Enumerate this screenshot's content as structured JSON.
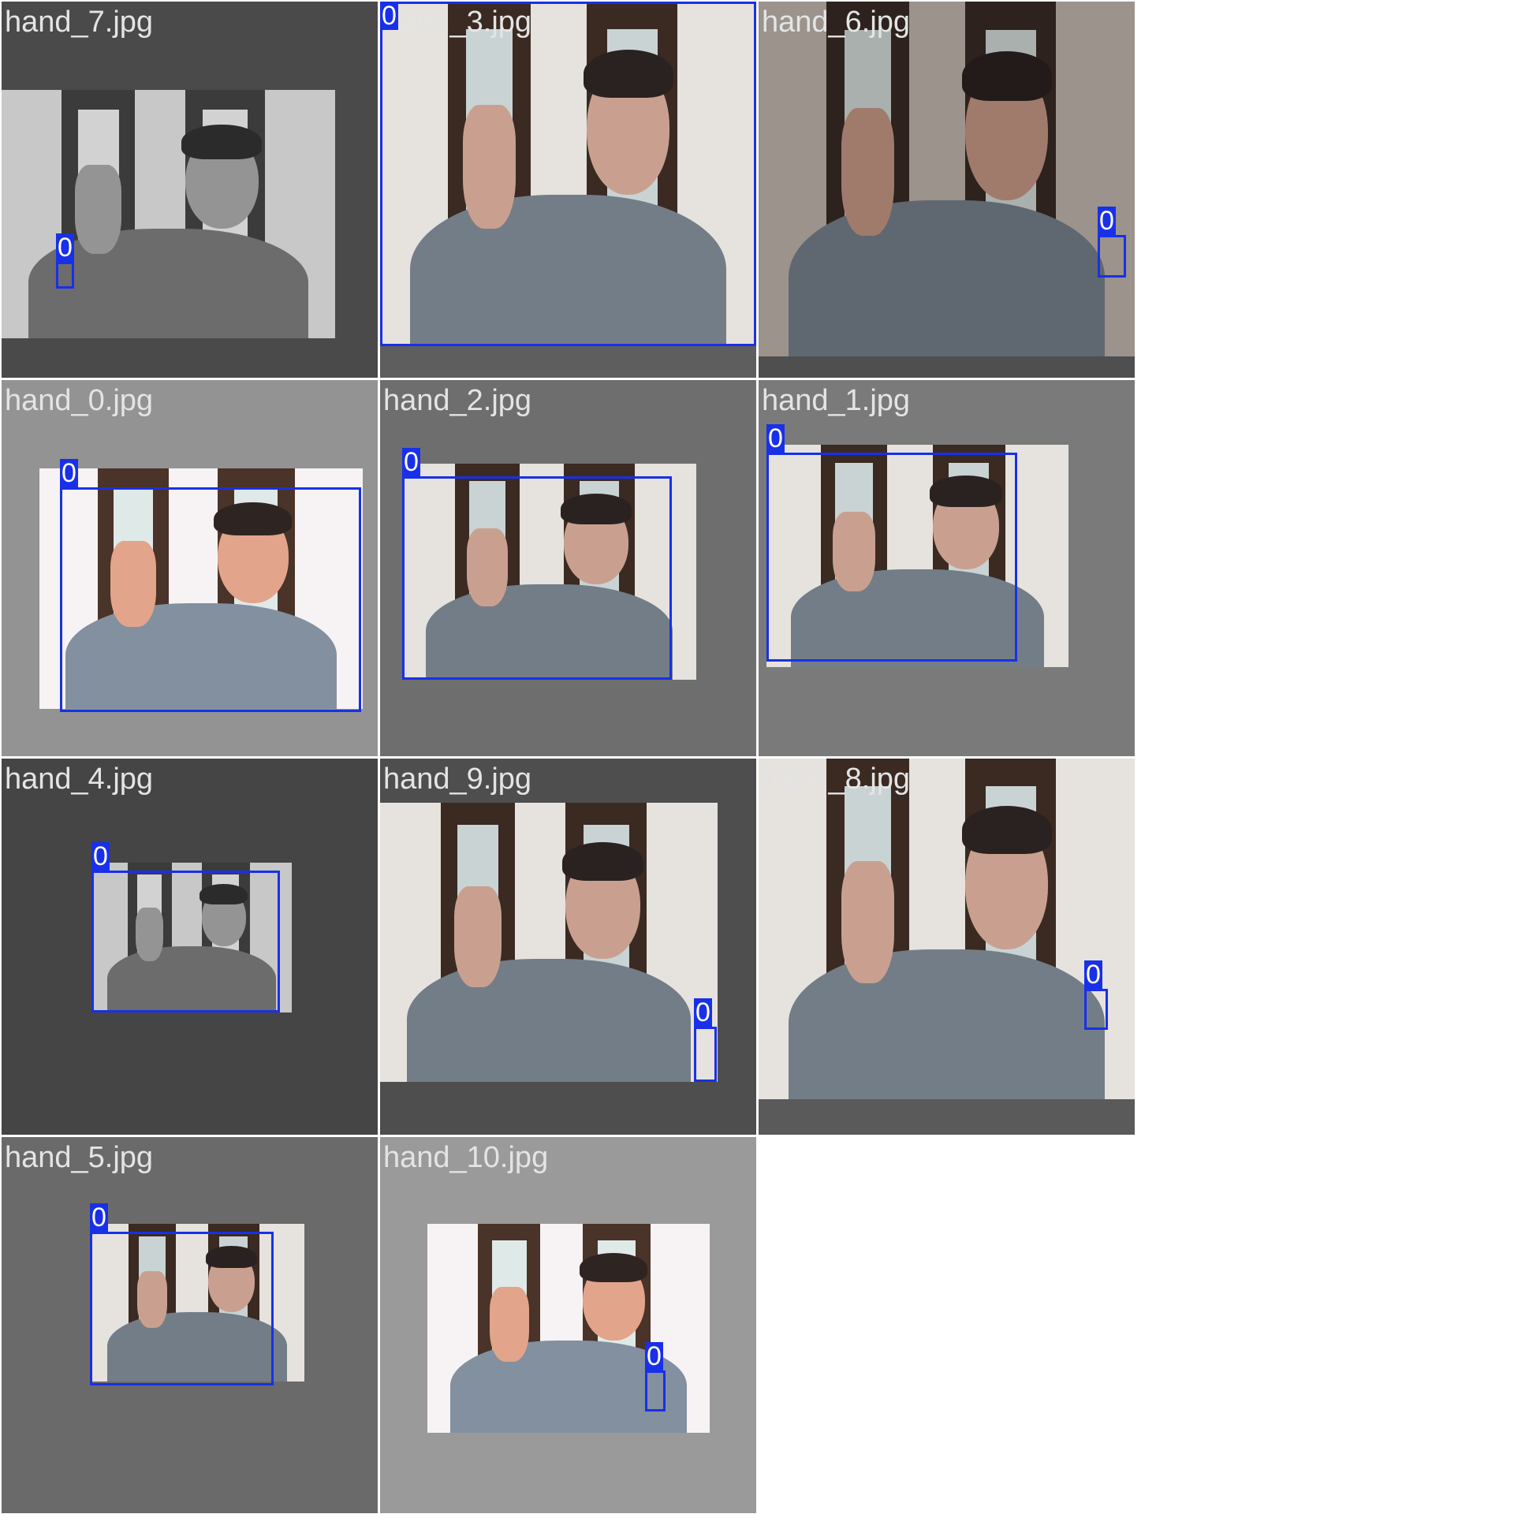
{
  "colors": {
    "box": "#1830e8",
    "label_text": "#e4e4e4"
  },
  "tiles": [
    {
      "label": "hand_7.jpg",
      "class_id": "0",
      "bg": "#4a4a4a",
      "photo_tone": "gray"
    },
    {
      "label": "hand_3.jpg",
      "class_id": "0",
      "bg": "#5e5e5e",
      "photo_tone": "color"
    },
    {
      "label": "hand_6.jpg",
      "class_id": "0",
      "bg": "#4f4f4f",
      "photo_tone": "dim"
    },
    {
      "label": "hand_0.jpg",
      "class_id": "0",
      "bg": "#939393",
      "photo_tone": "bright"
    },
    {
      "label": "hand_2.jpg",
      "class_id": "0",
      "bg": "#6e6e6e",
      "photo_tone": "color"
    },
    {
      "label": "hand_1.jpg",
      "class_id": "0",
      "bg": "#7a7a7a",
      "photo_tone": "color"
    },
    {
      "label": "hand_4.jpg",
      "class_id": "0",
      "bg": "#454545",
      "photo_tone": "gray"
    },
    {
      "label": "hand_9.jpg",
      "class_id": "0",
      "bg": "#4e4e4e",
      "photo_tone": "color"
    },
    {
      "label": "hand_8.jpg",
      "class_id": "0",
      "bg": "#5a5a5a",
      "photo_tone": "color"
    },
    {
      "label": "hand_5.jpg",
      "class_id": "0",
      "bg": "#6a6a6a",
      "photo_tone": "color"
    },
    {
      "label": "hand_10.jpg",
      "class_id": "0",
      "bg": "#9a9a9a",
      "photo_tone": "bright"
    }
  ]
}
